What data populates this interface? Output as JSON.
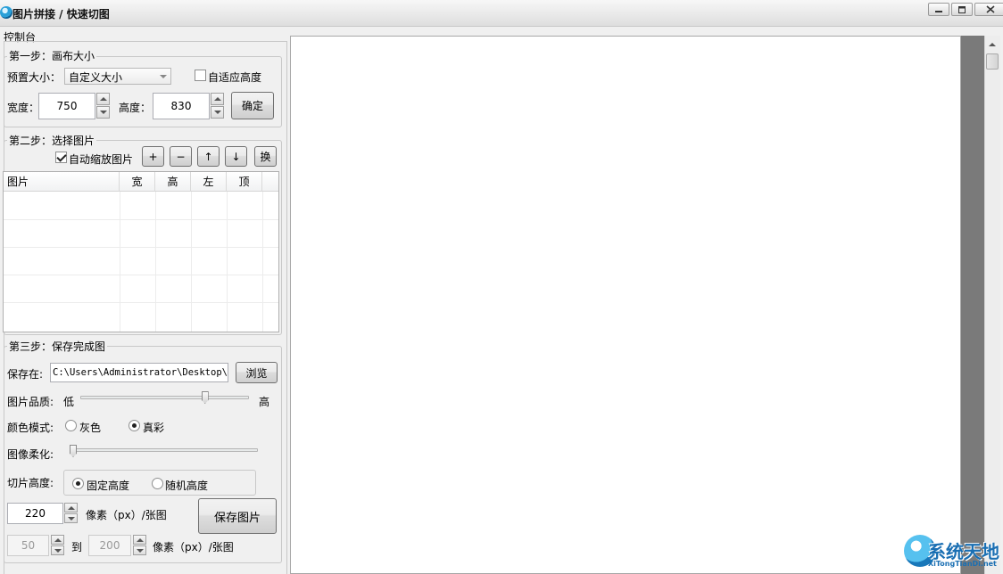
{
  "window": {
    "title": "图片拼接 / 快速切图",
    "controls": [
      "minimize-icon",
      "maximize-icon",
      "close-icon"
    ]
  },
  "panel": {
    "label": "控制台",
    "step1": {
      "legend": "第一步：画布大小",
      "preset_label": "预置大小：",
      "preset_value": "自定义大小",
      "auto_height_label": "自适应高度",
      "auto_height_checked": false,
      "width_label": "宽度：",
      "width_value": "750",
      "height_label": "高度：",
      "height_value": "830",
      "confirm_label": "确定"
    },
    "step2": {
      "legend": "第二步：选择图片",
      "auto_scale_label": "自动缩放图片",
      "auto_scale_checked": true,
      "tool_buttons": [
        "+",
        "−",
        "↑",
        "↓",
        "换"
      ],
      "columns": [
        "图片",
        "宽",
        "高",
        "左",
        "顶"
      ],
      "rows": []
    },
    "step3": {
      "legend": "第三步：保存完成图",
      "save_in_label": "保存在:",
      "save_path": "C:\\Users\\Administrator\\Desktop\\下",
      "browse_label": "浏览",
      "quality_label": "图片品质:",
      "quality_low": "低",
      "quality_high": "高",
      "quality_level": 0.75,
      "color_mode_label": "颜色模式:",
      "color_gray": "灰色",
      "color_true": "真彩",
      "color_selected": "真彩",
      "soften_label": "图像柔化:",
      "soften_level": 0.0,
      "slice_height_label": "切片高度:",
      "fixed_height_label": "固定高度",
      "random_height_label": "随机高度",
      "slice_selected": "固定高度",
      "fixed_value": "220",
      "unit_label": "像素（px）/张图",
      "random_min": "50",
      "to_label": "到",
      "random_max": "200",
      "unit_label2": "像素（px）/张图",
      "save_button": "保存图片"
    }
  },
  "watermark": {
    "brand": "系统天地",
    "url": "XiTongTianDi.net"
  }
}
